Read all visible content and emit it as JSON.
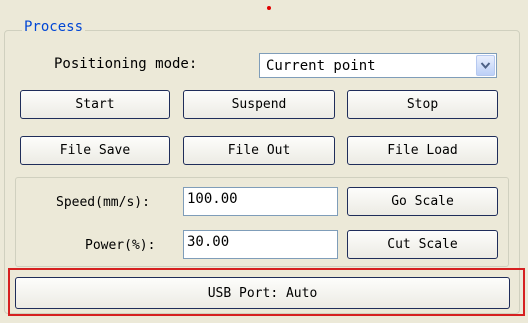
{
  "group": {
    "title": "Process"
  },
  "positioning": {
    "label": "Positioning mode:",
    "selected": "Current point"
  },
  "buttons": {
    "start": "Start",
    "suspend": "Suspend",
    "stop": "Stop",
    "file_save": "File Save",
    "file_out": "File Out",
    "file_load": "File Load",
    "go_scale": "Go Scale",
    "cut_scale": "Cut Scale",
    "usb_port": "USB Port: Auto"
  },
  "speed": {
    "label": "Speed(mm/s):",
    "value": "100.00"
  },
  "power": {
    "label": "Power(%):",
    "value": "30.00"
  },
  "icons": {
    "dropdown": "chevron-down-icon"
  },
  "colors": {
    "group_title": "#0046d5",
    "highlight_border": "#d62020",
    "background": "#ece9d8"
  }
}
